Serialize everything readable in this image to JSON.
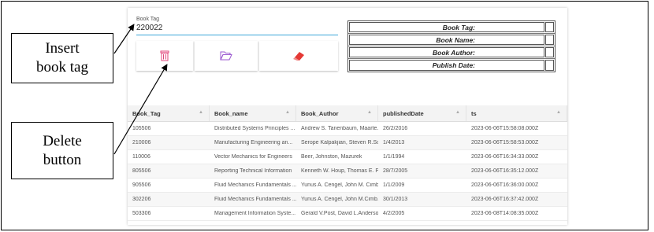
{
  "callouts": {
    "insert": [
      "Insert",
      "book tag"
    ],
    "delete": [
      "Delete",
      "button"
    ]
  },
  "form": {
    "label": "Book Tag",
    "value": "220022"
  },
  "buttons": [
    {
      "icon": "trash-icon",
      "color": "#e0457b"
    },
    {
      "icon": "folder-open-icon",
      "color": "#9b59d0"
    },
    {
      "icon": "eraser-icon",
      "color": "#e53935"
    }
  ],
  "info": {
    "book_tag": "Book Tag:",
    "book_name": "Book Name:",
    "book_author": "Book Author:",
    "publish_date": "Publish Date:"
  },
  "table": {
    "columns": [
      "Book_Tag",
      "Book_name",
      "Book_Author",
      "publishedDate",
      "ts"
    ],
    "rows": [
      [
        "105506",
        "Distributed Systems Principles ...",
        "Andrew S. Tanenbaum, Maarte...",
        "26/2/2016",
        "2023-06-06T15:58:08.000Z"
      ],
      [
        "210006",
        "Manufacturing Engineering an...",
        "Serope Kalpakjian, Steven R.Sc...",
        "1/4/2013",
        "2023-06-06T15:58:53.000Z"
      ],
      [
        "110006",
        "Vector Mechanics for Engineers",
        "Beer, Johnston, Mazurek",
        "1/1/1994",
        "2023-06-06T16:34:33.000Z"
      ],
      [
        "805506",
        "Reporting Technical Information",
        "Kenneth W. Houp, Thomas E. P...",
        "28/7/2005",
        "2023-06-06T16:35:12.000Z"
      ],
      [
        "905506",
        "Fluid Mechanics Fundamentals ...",
        "Yunus A. Cengel, John M. Cimb...",
        "1/1/2009",
        "2023-06-06T16:36:00.000Z"
      ],
      [
        "302206",
        "Fluid Mechanics Fundamentals ...",
        "Yunus A. Cengel, John M.Cimb...",
        "30/1/2013",
        "2023-06-06T16:37:42.000Z"
      ],
      [
        "503306",
        "Management Information Syste...",
        "Gerald V.Post, David L.Anderson",
        "4/2/2005",
        "2023-06-08T14:08:35.000Z"
      ]
    ]
  }
}
